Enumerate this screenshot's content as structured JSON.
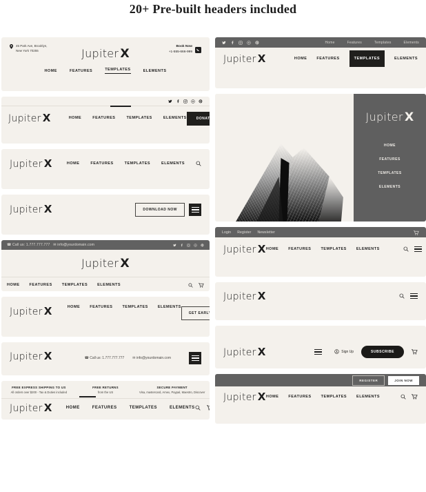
{
  "page": {
    "title": "20+ Pre-built headers included"
  },
  "brand": {
    "name": "Jupiter",
    "mark": "X"
  },
  "nav": {
    "home": "HOME",
    "features": "FEATURES",
    "templates": "TEMPLATES",
    "elements": "ELEMENTS"
  },
  "nav_secondary": {
    "home": "Home",
    "features": "Features",
    "templates": "Templates",
    "elements": "Elements"
  },
  "headers": {
    "h1_address_line1": "45 Park Ave, Brooklyn,",
    "h1_address_line2": "New York 70255",
    "h1_book_now": "Book Now",
    "h1_phone": "+1-555-666-999",
    "h2_donate": "DONATE",
    "h4_download": "DOWNLOAD NOW",
    "h5_call": "Call us: 1.777.777.777",
    "h5_email": "info@yourdomain.com",
    "h6_early_access": "GET EARLY ACCESS",
    "h7_call": "Call us: 1.777.777.777",
    "h7_email": "info@yourdomain.com",
    "h8_feat1_title": "FREE EXPRESS SHIPPING TO US",
    "h8_feat1_sub": "All orders over $200 - Tax & Duties included",
    "h8_feat2_title": "FREE RETURNS",
    "h8_feat2_sub": "from the US",
    "h8_feat3_title": "SECURE PAYMENT",
    "h8_feat3_sub": "Visa, mastercard, Amex, Paypal, Maestro, Discover",
    "r3_login": "Login",
    "r3_register": "Register",
    "r3_newsletter": "Newsletter",
    "r5_signup": "Sign Up",
    "r5_subscribe": "SUBSCRIBE",
    "r6_register": "REGISTER",
    "r6_join": "JOIN NOW"
  },
  "colors": {
    "card_bg": "#f4f1ec",
    "dark_bar": "#616161",
    "accent_dark": "#201f1d",
    "text": "#1d1d1d",
    "page_bg": "#ffffff"
  }
}
